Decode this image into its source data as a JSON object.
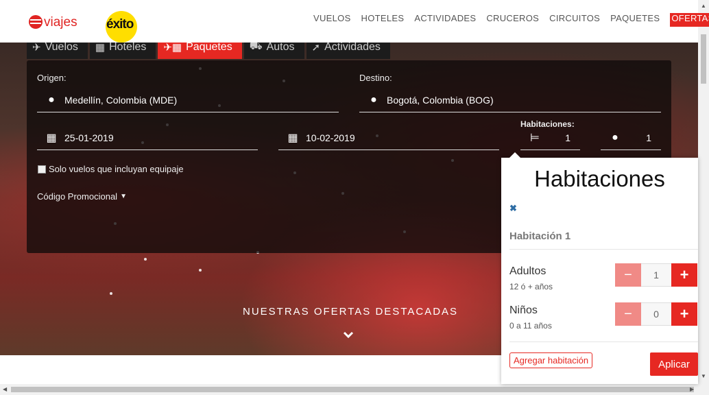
{
  "header": {
    "logo_text": "viajes",
    "logo_brand": "éxito",
    "nav": [
      "VUELOS",
      "HOTELES",
      "ACTIVIDADES",
      "CRUCEROS",
      "CIRCUITOS",
      "PAQUETES",
      "OFERTAS"
    ]
  },
  "tabs": [
    {
      "label": "Vuelos",
      "icon": "plane-icon"
    },
    {
      "label": "Hoteles",
      "icon": "hotel-icon"
    },
    {
      "label": "Paquetes",
      "icon": "package-icon",
      "active": true
    },
    {
      "label": "Autos",
      "icon": "car-icon"
    },
    {
      "label": "Actividades",
      "icon": "activity-icon"
    }
  ],
  "search": {
    "origin_label": "Origen:",
    "origin_value": "Medellín, Colombia (MDE)",
    "destination_label": "Destino:",
    "destination_value": "Bogotá, Colombia (BOG)",
    "date_from": "25-01-2019",
    "date_to": "10-02-2019",
    "rooms_label": "Habitaciones:",
    "rooms_value": "1",
    "people_value": "1",
    "baggage_label": "Solo vuelos que incluyan equipaje",
    "promo_label": "Código Promocional"
  },
  "hero": {
    "offers_title": "NUESTRAS OFERTAS DESTACADAS"
  },
  "rooms_popup": {
    "title": "Habitaciones",
    "room_label": "Habitación 1",
    "adults_label": "Adultos",
    "adults_sub": "12 ó + años",
    "adults_value": "1",
    "children_label": "Niños",
    "children_sub": "0 a 11 años",
    "children_value": "0",
    "add_room_label": "Agregar habitación",
    "apply_label": "Aplicar"
  },
  "colors": {
    "brand_red": "#e62822",
    "brand_yellow": "#ffde00"
  }
}
